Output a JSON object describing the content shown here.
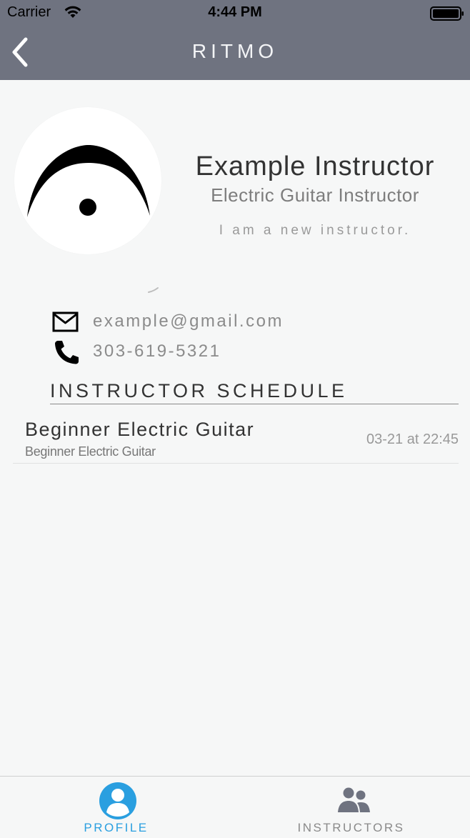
{
  "status_bar": {
    "carrier": "Carrier",
    "time": "4:44 PM"
  },
  "nav": {
    "title": "RITMO",
    "back_icon": "chevron-left-icon"
  },
  "profile": {
    "avatar_icon": "fermata-icon",
    "name": "Example Instructor",
    "role": "Electric Guitar Instructor",
    "bio": "I am a new instructor."
  },
  "contact": {
    "email": "example@gmail.com",
    "email_icon": "mail-icon",
    "phone": "303-619-5321",
    "phone_icon": "phone-icon"
  },
  "schedule": {
    "heading": "INSTRUCTOR SCHEDULE",
    "items": [
      {
        "title": "Beginner Electric Guitar",
        "subtitle": "Beginner Electric Guitar",
        "time": "03-21 at 22:45"
      }
    ]
  },
  "tab_bar": {
    "tabs": [
      {
        "label": "PROFILE",
        "icon": "user-circle-icon",
        "selected": true
      },
      {
        "label": "INSTRUCTORS",
        "icon": "users-icon",
        "selected": false
      }
    ]
  },
  "colors": {
    "nav_background": "#6f7380",
    "page_background": "#f6f7f7",
    "active_tab": "#2a9fe0",
    "inactive_tab": "#6f7380"
  }
}
